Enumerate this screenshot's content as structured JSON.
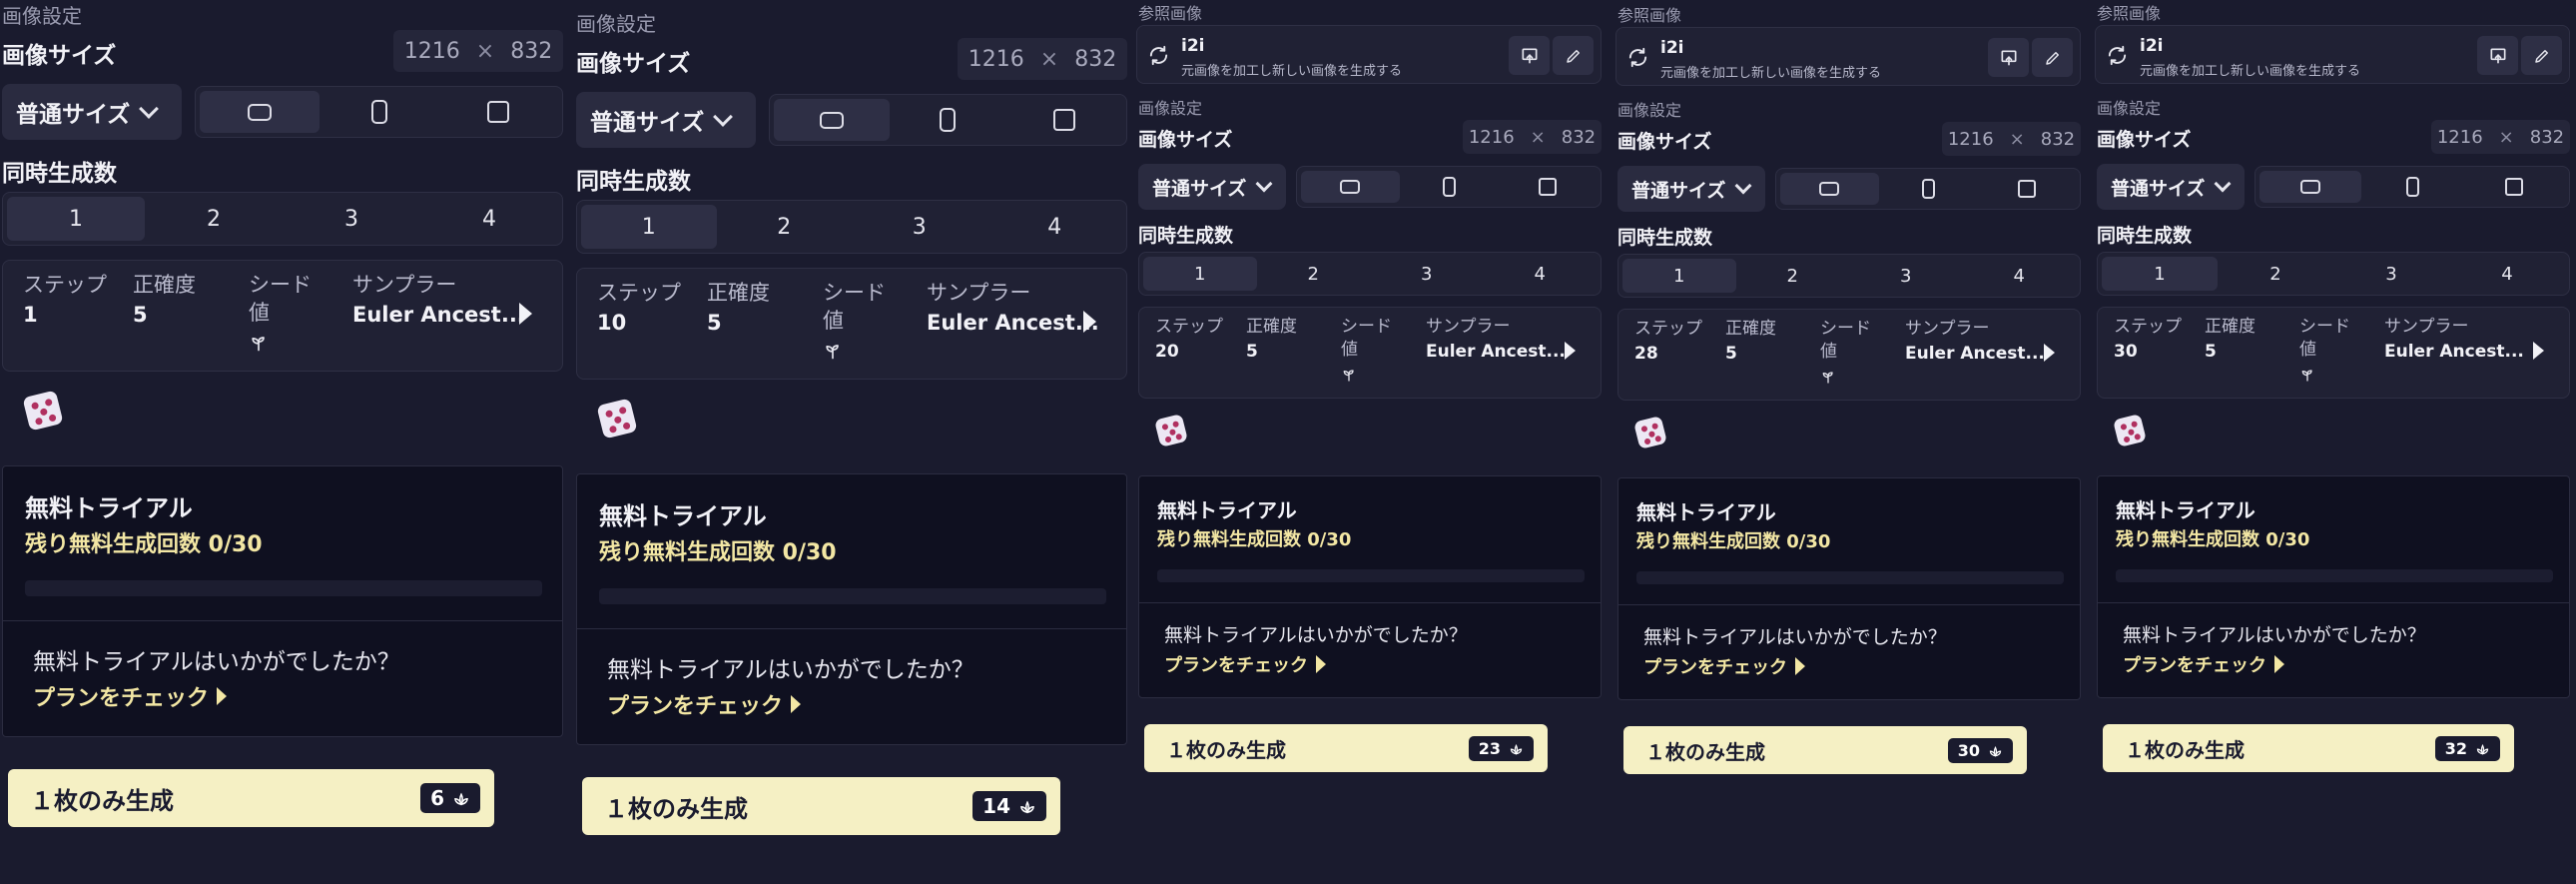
{
  "labels": {
    "image_settings": "画像設定",
    "reference_image": "参照画像",
    "image_size": "画像サイズ",
    "times": "×",
    "size_mode": "普通サイズ",
    "concurrent": "同時生成数",
    "step": "ステップ",
    "accuracy": "正確度",
    "seed_line1": "シード",
    "seed_line2": "値",
    "sampler": "サンプラー",
    "sampler_value": "Euler Ancest...",
    "i2i_name": "i2i",
    "i2i_desc": "元画像を加工し新しい画像を生成する",
    "trial_title": "無料トライアル",
    "trial_left": "残り無料生成回数 0/30",
    "trial_question": "無料トライアルはいかがでしたか？",
    "trial_plan": "プランをチェック",
    "generate_once": "１枚のみ生成"
  },
  "size": {
    "width": "1216",
    "height": "832"
  },
  "counts": [
    "1",
    "2",
    "3",
    "4"
  ],
  "accuracy_value": "5",
  "panels": [
    {
      "step": "1",
      "credits": "6",
      "has_reference": false
    },
    {
      "step": "10",
      "credits": "14",
      "has_reference": false
    },
    {
      "step": "20",
      "credits": "23",
      "has_reference": true
    },
    {
      "step": "28",
      "credits": "30",
      "has_reference": true
    },
    {
      "step": "30",
      "credits": "32",
      "has_reference": true
    }
  ],
  "icons": {
    "size_dropdown": "chevron-down-icon",
    "aspect_wide": "landscape-aspect-icon",
    "aspect_tall": "portrait-aspect-icon",
    "aspect_square": "square-aspect-icon",
    "seed": "sprout-icon",
    "sampler_more": "play-arrow-icon",
    "random": "dice-icon",
    "plan": "play-arrow-icon",
    "credit": "lotus-icon",
    "i2i": "refresh-icon",
    "upload": "upload-icon",
    "edit": "pencil-icon"
  },
  "colors": {
    "background": "#1a1b2e",
    "accent": "#f3e7a4",
    "generate_button": "#f5f0c4"
  }
}
